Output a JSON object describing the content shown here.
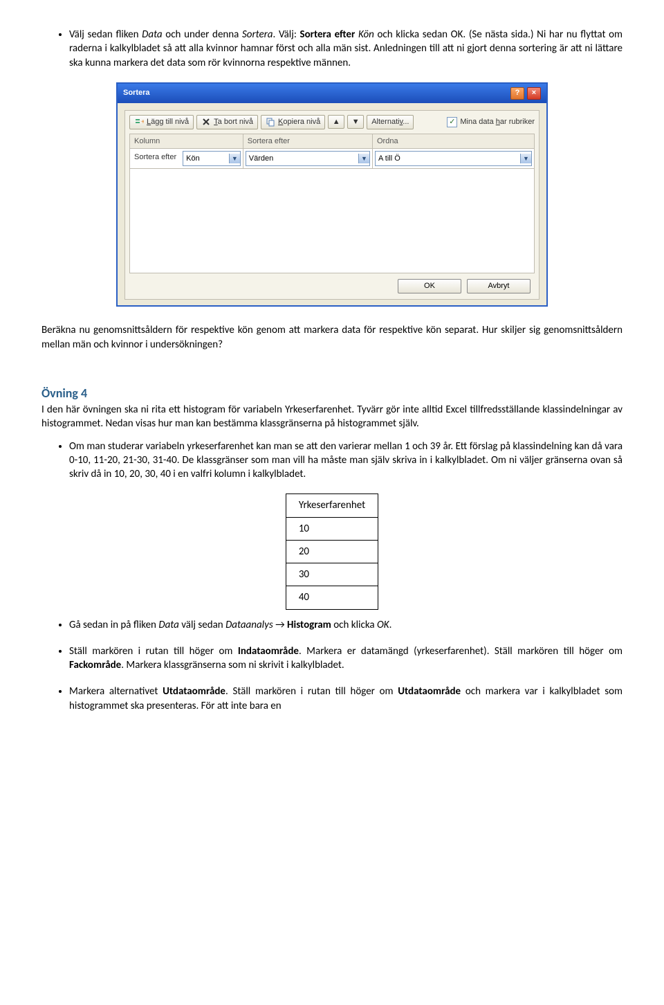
{
  "b1": {
    "p1a": "Välj sedan fliken ",
    "p1b": "Data",
    "p1c": " och under denna ",
    "p1d": "Sortera",
    "p1e": ". Välj: ",
    "p1f": "Sortera efter",
    "p1g": " ",
    "p1h": "Kön",
    "p1i": " och klicka sedan OK. (Se nästa sida.) Ni har nu flyttat om raderna i kalkylbladet så att alla kvinnor hamnar först och alla män sist. Anledningen till att ni gjort denna sortering är att ni lättare ska kunna markera det data som rör kvinnorna respektive männen."
  },
  "dialog": {
    "title": "Sortera",
    "btn_add": "Lägg till nivå",
    "btn_del": "Ta bort nivå",
    "btn_copy": "Kopiera nivå",
    "btn_alt": "Alternativ...",
    "chk_label": "Mina data har rubriker",
    "h_kolumn": "Kolumn",
    "h_sortera": "Sortera efter",
    "h_ordna": "Ordna",
    "row_label": "Sortera efter",
    "dd_kon": "Kön",
    "dd_varden": "Värden",
    "dd_atillo": "A till Ö",
    "ok": "OK",
    "cancel": "Avbryt"
  },
  "p2": "Beräkna nu genomsnittsåldern för respektive kön genom att markera data för respektive kön separat. Hur skiljer sig genomsnittsåldern mellan män och kvinnor i undersökningen?",
  "h4": "Övning 4",
  "p3": "I den här övningen ska ni rita ett histogram för variabeln Yrkeserfarenhet. Tyvärr gör inte alltid Excel tillfredsställande klassindelningar av histogrammet. Nedan visas hur man kan bestämma klassgränserna på histogrammet själv.",
  "b4": "Om man studerar variabeln yrkeserfarenhet kan man se att den varierar mellan 1 och 39 år. Ett förslag på klassindelning kan då vara 0-10, 11-20, 21-30, 31-40. De klassgränser som man vill ha måste man själv skriva in i kalkylbladet. Om ni väljer gränserna ovan så skriv då in 10, 20, 30, 40 i en valfri kolumn i kalkylbladet.",
  "mini": {
    "head": "Yrkeserfarenhet",
    "r1": "10",
    "r2": "20",
    "r3": "30",
    "r4": "40"
  },
  "b5": {
    "a": "Gå sedan in på fliken ",
    "b": "Data",
    "c": " välj sedan ",
    "d": "Dataanalys",
    "e": " → ",
    "f": "Histogram",
    "g": " och klicka ",
    "h": "OK",
    "i": "."
  },
  "b6": {
    "a": "Ställ markören i rutan till höger om ",
    "b": "Indataområde",
    "c": ". Markera er datamängd (yrkeserfarenhet). Ställ markören till höger om ",
    "d": "Fackområde",
    "e": ". Markera klassgränserna som ni skrivit i kalkylbladet."
  },
  "b7": {
    "a": "Markera alternativet ",
    "b": "Utdataområde",
    "c": ".  Ställ markören i rutan till höger om ",
    "d": "Utdataområde",
    "e": " och markera var i kalkylbladet som histogrammet ska presenteras. För att inte bara en"
  }
}
